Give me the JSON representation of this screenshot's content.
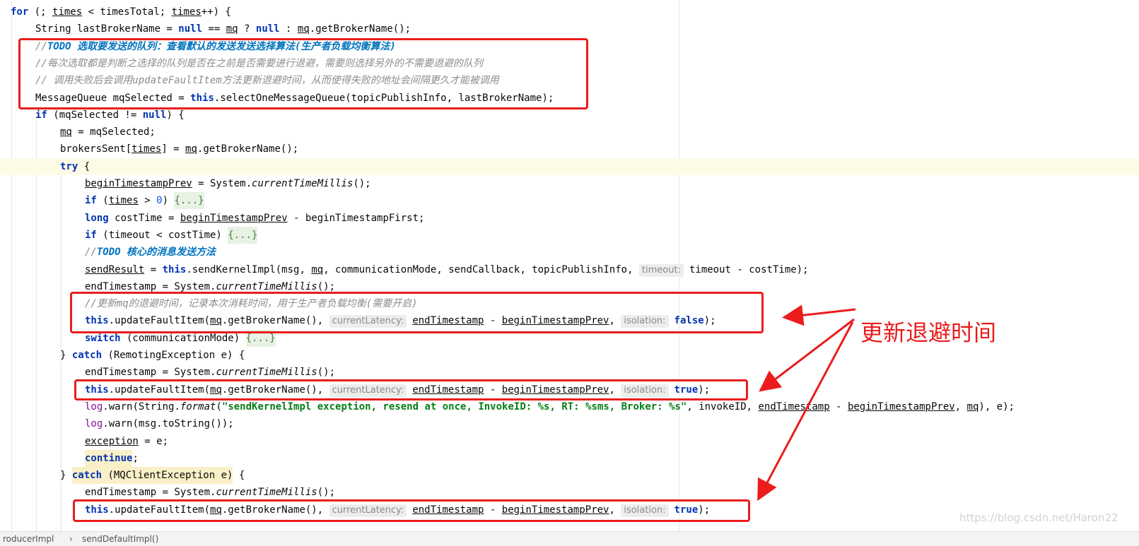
{
  "editor": {
    "lines": [
      [
        {
          "t": "for",
          "c": "kw"
        },
        {
          "t": " (; "
        },
        {
          "t": "times",
          "c": "u"
        },
        {
          "t": " < timesTotal; "
        },
        {
          "t": "times",
          "c": "u"
        },
        {
          "t": "++) {"
        }
      ],
      [
        {
          "t": "String lastBrokerName = "
        },
        {
          "t": "null",
          "c": "kw"
        },
        {
          "t": " == "
        },
        {
          "t": "mq",
          "c": "u"
        },
        {
          "t": " ? "
        },
        {
          "t": "null",
          "c": "kw"
        },
        {
          "t": " : "
        },
        {
          "t": "mq",
          "c": "u"
        },
        {
          "t": ".getBrokerName();"
        }
      ],
      [
        {
          "t": "//",
          "c": "cmt"
        },
        {
          "t": "TODO 选取要发送的队列：查看默认的发送发送选择算法(生产者负载均衡算法)",
          "c": "todo"
        }
      ],
      [
        {
          "t": "//每次选取都是判断之选择的队列是否在之前是否需要进行退避，需要则选择另外的不需要退避的队列",
          "c": "cmt"
        }
      ],
      [
        {
          "t": "// 调用失败后会调用updateFaultItem方法更新退避时间，从而使得失败的地址会间隔更久才能被调用",
          "c": "cmt"
        }
      ],
      [
        {
          "t": "MessageQueue mqSelected = "
        },
        {
          "t": "this",
          "c": "kw"
        },
        {
          "t": ".selectOneMessageQueue(topicPublishInfo, lastBrokerName);"
        }
      ],
      [
        {
          "t": "if",
          "c": "kw"
        },
        {
          "t": " (mqSelected != "
        },
        {
          "t": "null",
          "c": "kw"
        },
        {
          "t": ") {"
        }
      ],
      [
        {
          "t": "mq",
          "c": "u"
        },
        {
          "t": " = mqSelected;"
        }
      ],
      [
        {
          "t": "brokersSent["
        },
        {
          "t": "times",
          "c": "u"
        },
        {
          "t": "] = "
        },
        {
          "t": "mq",
          "c": "u"
        },
        {
          "t": ".getBrokerName();"
        }
      ],
      [
        {
          "t": "try",
          "c": "kw"
        },
        {
          "t": " {"
        }
      ],
      [
        {
          "t": "beginTimestampPrev",
          "c": "u"
        },
        {
          "t": " = System."
        },
        {
          "t": "currentTimeMillis",
          "c": "it"
        },
        {
          "t": "();"
        }
      ],
      [
        {
          "t": "if",
          "c": "kw"
        },
        {
          "t": " ("
        },
        {
          "t": "times",
          "c": "u"
        },
        {
          "t": " > "
        },
        {
          "t": "0",
          "c": "num"
        },
        {
          "t": ") "
        },
        {
          "t": "{...}",
          "c": "fold"
        }
      ],
      [
        {
          "t": "long",
          "c": "kw"
        },
        {
          "t": " costTime = "
        },
        {
          "t": "beginTimestampPrev",
          "c": "u"
        },
        {
          "t": " - beginTimestampFirst;"
        }
      ],
      [
        {
          "t": "if",
          "c": "kw"
        },
        {
          "t": " (timeout < costTime) "
        },
        {
          "t": "{...}",
          "c": "fold"
        }
      ],
      [
        {
          "t": "//",
          "c": "cmt"
        },
        {
          "t": "TODO 核心的消息发送方法",
          "c": "todo"
        }
      ],
      [
        {
          "t": "sendResult",
          "c": "u"
        },
        {
          "t": " = "
        },
        {
          "t": "this",
          "c": "kw"
        },
        {
          "t": ".sendKernelImpl(msg, "
        },
        {
          "t": "mq",
          "c": "u"
        },
        {
          "t": ", communicationMode, sendCallback, topicPublishInfo, "
        },
        {
          "t": "timeout:",
          "c": "hint"
        },
        {
          "t": "timeout - costTime);"
        }
      ],
      [
        {
          "t": "endTimestamp = System."
        },
        {
          "t": "currentTimeMillis",
          "c": "it"
        },
        {
          "t": "();"
        }
      ],
      [
        {
          "t": "//更新mq的退避时间，记录本次消耗时间，用于生产者负载均衡(需要开启)",
          "c": "cmt"
        }
      ],
      [
        {
          "t": "this",
          "c": "kw"
        },
        {
          "t": ".updateFaultItem("
        },
        {
          "t": "mq",
          "c": "u"
        },
        {
          "t": ".getBrokerName(), "
        },
        {
          "t": "currentLatency:",
          "c": "hint"
        },
        {
          "t": "endTimestamp",
          "c": "u"
        },
        {
          "t": " - "
        },
        {
          "t": "beginTimestampPrev",
          "c": "u"
        },
        {
          "t": ", "
        },
        {
          "t": "isolation:",
          "c": "hint"
        },
        {
          "t": "false",
          "c": "kw"
        },
        {
          "t": ");"
        }
      ],
      [
        {
          "t": "switch",
          "c": "kw"
        },
        {
          "t": " (communicationMode) "
        },
        {
          "t": "{...}",
          "c": "fold"
        }
      ],
      [
        {
          "t": "} "
        },
        {
          "t": "catch",
          "c": "kw"
        },
        {
          "t": " (RemotingException e) {"
        }
      ],
      [
        {
          "t": "endTimestamp = System."
        },
        {
          "t": "currentTimeMillis",
          "c": "it"
        },
        {
          "t": "();"
        }
      ],
      [
        {
          "t": "this",
          "c": "kw"
        },
        {
          "t": ".updateFaultItem("
        },
        {
          "t": "mq",
          "c": "u"
        },
        {
          "t": ".getBrokerName(), "
        },
        {
          "t": "currentLatency:",
          "c": "hint"
        },
        {
          "t": "endTimestamp",
          "c": "u"
        },
        {
          "t": " - "
        },
        {
          "t": "beginTimestampPrev",
          "c": "u"
        },
        {
          "t": ", "
        },
        {
          "t": "isolation:",
          "c": "hint"
        },
        {
          "t": "true",
          "c": "kw"
        },
        {
          "t": ");"
        }
      ],
      [
        {
          "t": "log",
          "c": "field"
        },
        {
          "t": ".warn(String."
        },
        {
          "t": "format",
          "c": "it"
        },
        {
          "t": "("
        },
        {
          "t": "\"sendKernelImpl exception, resend at once, InvokeID: %s, RT: %sms, Broker: %s\"",
          "c": "str"
        },
        {
          "t": ", invokeID, "
        },
        {
          "t": "endTimestamp",
          "c": "u"
        },
        {
          "t": " - "
        },
        {
          "t": "beginTimestampPrev",
          "c": "u"
        },
        {
          "t": ", "
        },
        {
          "t": "mq",
          "c": "u"
        },
        {
          "t": "), e);"
        }
      ],
      [
        {
          "t": "log",
          "c": "field"
        },
        {
          "t": ".warn(msg.toString());"
        }
      ],
      [
        {
          "t": "exception",
          "c": "u"
        },
        {
          "t": " = e;"
        }
      ],
      [
        {
          "t": "continue",
          "c": "kw hlbox"
        },
        {
          "t": ";"
        }
      ],
      [
        {
          "t": "} "
        },
        {
          "t": "catch",
          "c": "kw hlbox"
        },
        {
          "t": " (MQClientException e)",
          "c": "hlbox"
        },
        {
          "t": " {"
        }
      ],
      [
        {
          "t": "endTimestamp = System."
        },
        {
          "t": "currentTimeMillis",
          "c": "it"
        },
        {
          "t": "();"
        }
      ],
      [
        {
          "t": "this",
          "c": "kw"
        },
        {
          "t": ".updateFaultItem("
        },
        {
          "t": "mq",
          "c": "u"
        },
        {
          "t": ".getBrokerName(), "
        },
        {
          "t": "currentLatency:",
          "c": "hint"
        },
        {
          "t": "endTimestamp",
          "c": "u"
        },
        {
          "t": " - "
        },
        {
          "t": "beginTimestampPrev",
          "c": "u"
        },
        {
          "t": ", "
        },
        {
          "t": "isolation:",
          "c": "hint"
        },
        {
          "t": "true",
          "c": "kw"
        },
        {
          "t": ");"
        }
      ]
    ]
  },
  "status_bar": {
    "crumb_left": "roducerImpl",
    "separator": "›",
    "crumb_right": "sendDefaultImpl()"
  },
  "annotation": {
    "label": "更新退避时间",
    "color": "#ea1c1c"
  },
  "watermark": "https://blog.csdn.net/Haron22"
}
